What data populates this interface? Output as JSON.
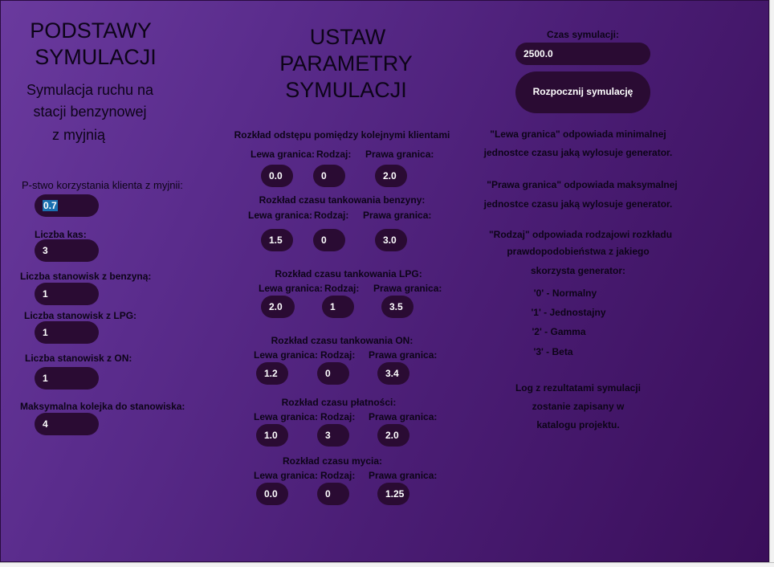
{
  "left": {
    "title_line1": "PODSTAWY",
    "title_line2": "SYMULACJI",
    "subtitle_line1": "Symulacja ruchu na",
    "subtitle_line2": "stacji benzynowej",
    "subtitle_line3": "z myjnią",
    "prob_label": "P-stwo korzystania klienta z myjnii:",
    "prob_value": "0.7",
    "kasy_label": "Liczba kas:",
    "kasy_value": "3",
    "benzyna_label": "Liczba stanowisk z benzyną:",
    "benzyna_value": "1",
    "lpg_label": "Liczba stanowisk z LPG:",
    "lpg_value": "1",
    "on_label": "Liczba stanowisk z ON:",
    "on_value": "1",
    "kolejka_label": "Maksymalna kolejka do stanowiska:",
    "kolejka_value": "4"
  },
  "middle": {
    "title_line1": "USTAW",
    "title_line2": "PARAMETRY",
    "title_line3": "SYMULACJI",
    "col_left": "Lewa granica:",
    "col_kind": "Rodzaj:",
    "col_right": "Prawa granica:",
    "groups": [
      {
        "title": "Rozkład odstępu pomiędzy kolejnymi klientami",
        "left": "0.0",
        "kind": "0",
        "right": "2.0"
      },
      {
        "title": "Rozkład czasu tankowania benzyny:",
        "left": "1.5",
        "kind": "0",
        "right": "3.0"
      },
      {
        "title": "Rozkład czasu tankowania LPG:",
        "left": "2.0",
        "kind": "1",
        "right": "3.5"
      },
      {
        "title": "Rozkład czasu tankowania ON:",
        "left": "1.2",
        "kind": "0",
        "right": "3.4"
      },
      {
        "title": "Rozkład czasu płatności:",
        "left": "1.0",
        "kind": "3",
        "right": "2.0"
      },
      {
        "title": "Rozkład czasu mycia:",
        "left": "0.0",
        "kind": "0",
        "right": "1.25"
      }
    ]
  },
  "right": {
    "time_label": "Czas symulacji:",
    "time_value": "2500.0",
    "start_button": "Rozpocznij symulację",
    "info_lines": [
      "\"Lewa granica\" odpowiada minimalnej",
      "jednostce czasu jaką wylosuje generator.",
      "\"Prawa granica\" odpowiada maksymalnej",
      "jednostce czasu jaką wylosuje generator.",
      "\"Rodzaj\" odpowiada rodzajowi rozkładu",
      "prawdopodobieństwa z jakiego",
      "skorzysta generator:",
      "'0' - Normalny",
      "'1' - Jednostajny",
      "'2' - Gamma",
      "'3' - Beta",
      "Log z rezultatami symulacji",
      "zostanie zapisany w",
      "katalogu projektu."
    ]
  }
}
